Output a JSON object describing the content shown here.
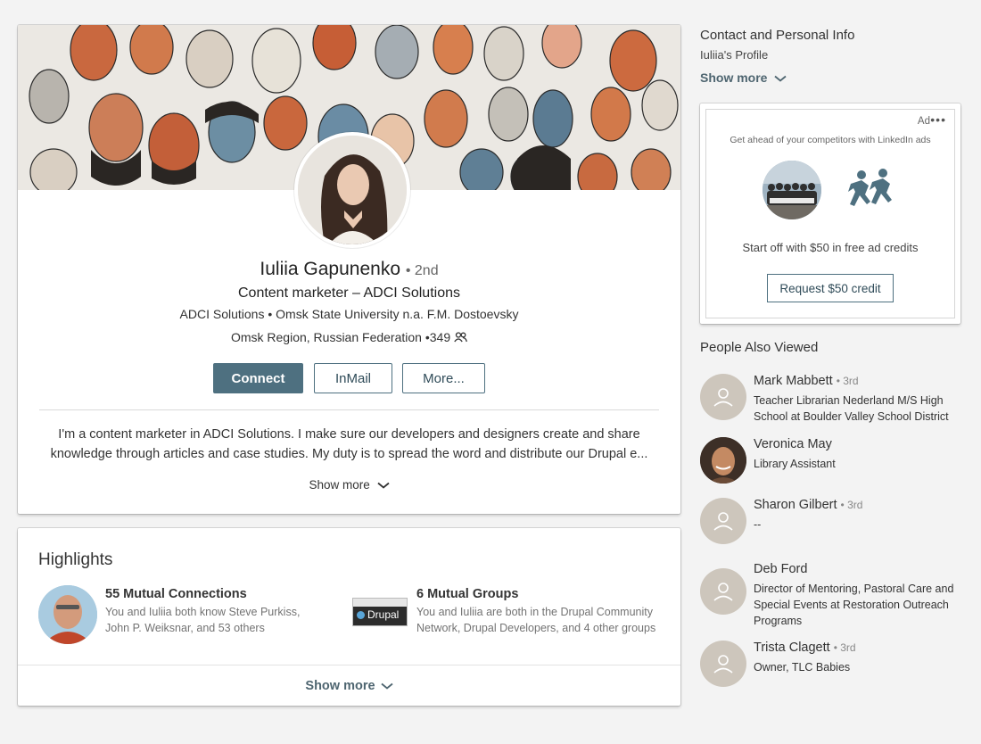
{
  "profile": {
    "name": "Iuliia Gapunenko",
    "degree": "• 2nd",
    "headline": "Content marketer – ADCI Solutions",
    "company": "ADCI Solutions",
    "school": "Omsk State University n.a. F.M. Dostoevsky",
    "location": "Omsk Region, Russian Federation",
    "connections": "349",
    "summary_line1": "I'm a content marketer in ADCI Solutions. I make sure our developers and designers create and share",
    "summary_line2": "knowledge through articles and case studies. My duty is to spread the word and distribute our Drupal e...",
    "show_more": "Show more"
  },
  "actions": {
    "connect": "Connect",
    "inmail": "InMail",
    "more": "More..."
  },
  "highlights": {
    "title": "Highlights",
    "mutual_connections": {
      "title": "55 Mutual Connections",
      "desc": "You and Iuliia both know Steve Purkiss, John P. Weiksnar, and 53 others"
    },
    "mutual_groups": {
      "title": "6 Mutual Groups",
      "desc": "You and Iuliia are both in the Drupal Community Network, Drupal Developers, and 4 other groups",
      "logo_text": "Drupal"
    },
    "show_more": "Show more"
  },
  "contact": {
    "title": "Contact and Personal Info",
    "subtitle": "Iuliia's Profile",
    "show_more": "Show more"
  },
  "ad": {
    "label": "Ad",
    "tagline": "Get ahead of your competitors with LinkedIn ads",
    "copy": "Start off with $50 in free ad credits",
    "button": "Request $50 credit"
  },
  "people_also_viewed": {
    "title": "People Also Viewed",
    "items": [
      {
        "name": "Mark Mabbett",
        "degree": "• 3rd",
        "headline": "Teacher Librarian Nederland M/S High School at Boulder Valley School District"
      },
      {
        "name": "Veronica May",
        "degree": "",
        "headline": "Library Assistant"
      },
      {
        "name": "Sharon Gilbert",
        "degree": "• 3rd",
        "headline": "--"
      },
      {
        "name": "Deb Ford",
        "degree": "",
        "headline": "Director of Mentoring, Pastoral Care and Special Events at Restoration Outreach Programs"
      },
      {
        "name": "Trista Clagett",
        "degree": "• 3rd",
        "headline": "Owner, TLC Babies"
      }
    ]
  },
  "colors": {
    "primary": "#4e7080",
    "page_bg": "#f3f3f3",
    "link": "#4e6570"
  }
}
